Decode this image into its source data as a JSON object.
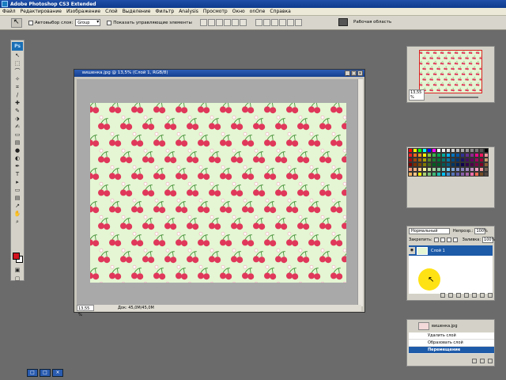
{
  "window": {
    "title": "Adobe Photoshop CS3 Extended"
  },
  "menu": [
    "Файл",
    "Редактирование",
    "Изображение",
    "Слой",
    "Выделение",
    "Фильтр",
    "Analysis",
    "Просмотр",
    "Окно",
    "onOne",
    "Справка"
  ],
  "options": {
    "auto_select_label": "Автовыбор слоя:",
    "auto_select_value": "Group",
    "show_controls_label": "Показать управляющие элементы",
    "workspace_label": "Рабочая область"
  },
  "toolbox": {
    "logo": "Ps",
    "tools": [
      "move-tool",
      "marquee-tool",
      "lasso-tool",
      "magic-wand-tool",
      "crop-tool",
      "slice-tool",
      "healing-tool",
      "brush-tool",
      "stamp-tool",
      "history-brush-tool",
      "eraser-tool",
      "gradient-tool",
      "blur-tool",
      "dodge-tool",
      "pen-tool",
      "type-tool",
      "path-select-tool",
      "shape-tool",
      "notes-tool",
      "eyedropper-tool",
      "hand-tool",
      "zoom-tool"
    ],
    "foreground_color": "#d3131f",
    "background_color": "#ffffff"
  },
  "document": {
    "title": "вишенка.jpg @ 13,5% (Слой 1, RGB/8)",
    "zoom": "13,55 %",
    "doc_info": "Док: 45,0M/45,0M",
    "pattern_bg": "#e4f6d3",
    "cherry_color": "#e0385a"
  },
  "navigator": {
    "zoom": "13,55 %"
  },
  "swatches": {
    "colors": [
      "#ff0000",
      "#ffff00",
      "#00ff00",
      "#00ffff",
      "#0000ff",
      "#ff00ff",
      "#ffffff",
      "#eeeeee",
      "#dddddd",
      "#cccccc",
      "#bbbbbb",
      "#aaaaaa",
      "#999999",
      "#888888",
      "#777777",
      "#555555",
      "#000000",
      "#ee1c24",
      "#f26522",
      "#f7941d",
      "#fff200",
      "#8dc63f",
      "#39b54a",
      "#00a651",
      "#00a99d",
      "#00aeef",
      "#0072bc",
      "#0054a6",
      "#2e3192",
      "#662d91",
      "#92278f",
      "#ec008c",
      "#ed145b",
      "#f5989d",
      "#9e0b0f",
      "#a0410d",
      "#a3620a",
      "#aba000",
      "#598527",
      "#197b30",
      "#007236",
      "#00746b",
      "#0076a3",
      "#004a80",
      "#003471",
      "#1b1464",
      "#440e62",
      "#630460",
      "#9e005d",
      "#9e0039",
      "#c69c6d",
      "#790000",
      "#7b2e00",
      "#7d4900",
      "#827b00",
      "#406618",
      "#005e20",
      "#005826",
      "#005952",
      "#005b7f",
      "#003663",
      "#002157",
      "#0d004c",
      "#32004b",
      "#4b0049",
      "#7b0046",
      "#7a0026",
      "#8c6239",
      "#f69679",
      "#f9ad81",
      "#fdc689",
      "#fff799",
      "#c4df9b",
      "#a3d39c",
      "#82ca9d",
      "#7bcdc8",
      "#6ecff6",
      "#7ea7d8",
      "#8493ca",
      "#8882be",
      "#a186be",
      "#bc8dbf",
      "#f49ac2",
      "#f6989d",
      "#736357",
      "#fbaf5d",
      "#fdc68a",
      "#fff200",
      "#acd373",
      "#7cc576",
      "#3cb878",
      "#1cbbb4",
      "#00bff3",
      "#448ccb",
      "#5674b9",
      "#605ca8",
      "#855fa8",
      "#a864a8",
      "#f06eaa",
      "#f26c4f",
      "#754c24",
      "#534741"
    ]
  },
  "layers": {
    "blend_mode": "Нормальный",
    "opacity_label": "Непрозр.:",
    "opacity": "100%",
    "lock_label": "Закрепить:",
    "fill_label": "Заливка:",
    "fill": "100%",
    "items": [
      {
        "name": "Слой 1"
      }
    ]
  },
  "history": {
    "snapshot": "вишенка.jpg",
    "items": [
      "Удалить слой",
      "Образовать слой",
      "Перемещение"
    ],
    "selected_index": 2
  },
  "minimized": [
    "□",
    "□",
    "×"
  ]
}
